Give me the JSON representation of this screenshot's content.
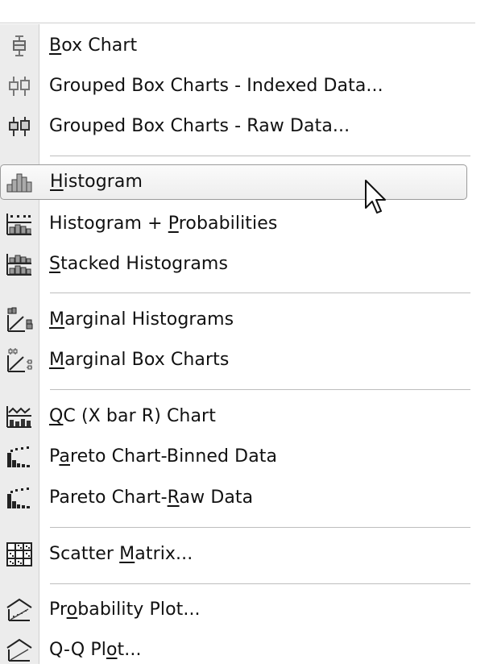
{
  "menu": {
    "items": [
      {
        "id": "box-chart",
        "pre": "",
        "key": "B",
        "post": "ox Chart",
        "icon": "box-chart-icon"
      },
      {
        "id": "grouped-box-indexed",
        "pre": "Grouped Box Charts - Indexed Data...",
        "key": "",
        "post": "",
        "icon": "grouped-box-indexed-icon"
      },
      {
        "id": "grouped-box-raw",
        "pre": "Grouped Box Charts - Raw Data...",
        "key": "",
        "post": "",
        "icon": "grouped-box-raw-icon"
      },
      {
        "id": "histogram",
        "pre": "",
        "key": "H",
        "post": "istogram",
        "icon": "histogram-icon",
        "highlighted": true
      },
      {
        "id": "histogram-probabilities",
        "pre": "Histogram + ",
        "key": "P",
        "post": "robabilities",
        "icon": "histogram-probabilities-icon"
      },
      {
        "id": "stacked-histograms",
        "pre": "",
        "key": "S",
        "post": "tacked Histograms",
        "icon": "stacked-histograms-icon"
      },
      {
        "id": "marginal-histograms",
        "pre": "",
        "key": "M",
        "post": "arginal Histograms",
        "icon": "marginal-histograms-icon"
      },
      {
        "id": "marginal-box-charts",
        "pre": "",
        "key": "M",
        "post": "arginal Box Charts",
        "icon": "marginal-box-charts-icon"
      },
      {
        "id": "qc-chart",
        "pre": "",
        "key": "Q",
        "post": "C (X bar R) Chart",
        "icon": "qc-chart-icon"
      },
      {
        "id": "pareto-binned",
        "pre": "P",
        "key": "a",
        "post": "reto Chart-Binned Data",
        "icon": "pareto-binned-icon"
      },
      {
        "id": "pareto-raw",
        "pre": "Pareto Chart-",
        "key": "R",
        "post": "aw Data",
        "icon": "pareto-raw-icon"
      },
      {
        "id": "scatter-matrix",
        "pre": "Scatter ",
        "key": "M",
        "post": "atrix...",
        "icon": "scatter-matrix-icon"
      },
      {
        "id": "probability-plot",
        "pre": "Pr",
        "key": "o",
        "post": "bability Plot...",
        "icon": "probability-plot-icon"
      },
      {
        "id": "qq-plot",
        "pre": "Q-Q Pl",
        "key": "o",
        "post": "t...",
        "icon": "qq-plot-icon"
      }
    ]
  },
  "cursor": {
    "icon": "mouse-pointer-icon"
  },
  "colors": {
    "highlight_border": "#9a9a9a",
    "gutter": "#ececec",
    "separator": "#bdbdbd"
  }
}
